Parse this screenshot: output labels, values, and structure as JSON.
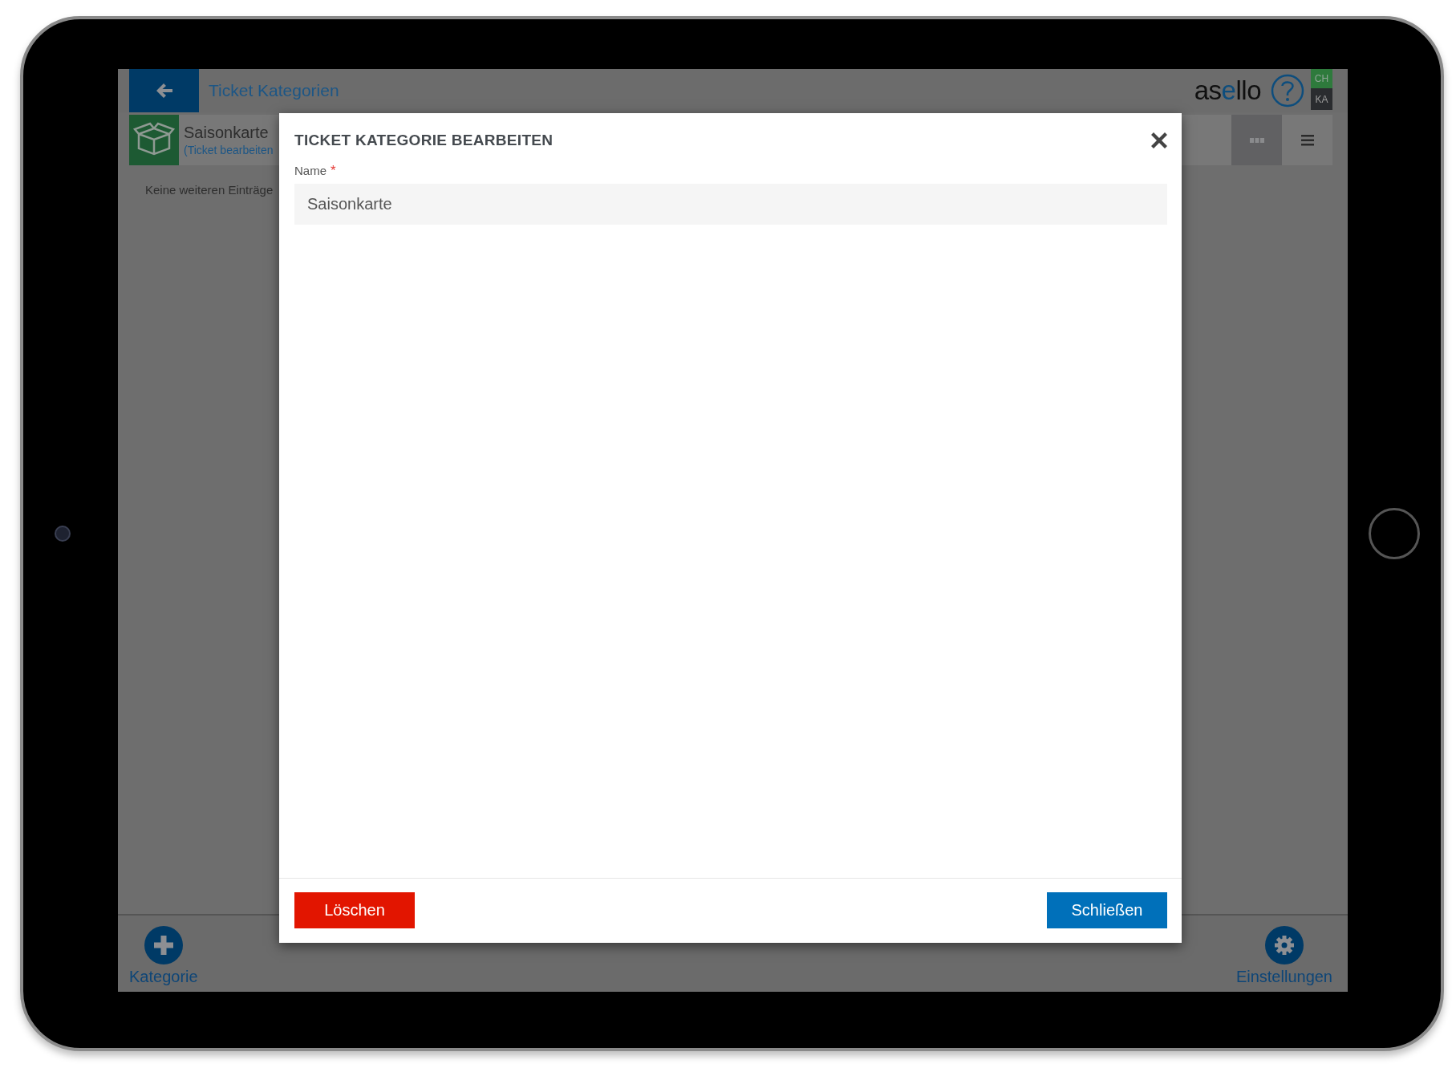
{
  "header": {
    "title": "Ticket Kategorien",
    "logo": [
      "as",
      "e",
      "llo"
    ],
    "badges": [
      {
        "label": "CH",
        "color": "#2e7a3c"
      },
      {
        "label": "KA",
        "color": "#2a2c2f"
      }
    ]
  },
  "item": {
    "name": "Saisonkarte",
    "subtitle": "(Ticket bearbeiten"
  },
  "empty_message": "Keine weiteren Einträge",
  "footer": [
    {
      "label": "Kategorie",
      "kind": "add"
    },
    {
      "label": "Einstellungen",
      "kind": "settings"
    }
  ],
  "dialog": {
    "title": "TICKET KATEGORIE BEARBEITEN",
    "fields": [
      {
        "label": "Name",
        "required_mark": "*",
        "value": "Saisonkarte"
      }
    ],
    "buttons": [
      {
        "label": "Löschen",
        "kind": "danger"
      },
      {
        "label": "Schließen",
        "kind": "primary"
      }
    ]
  }
}
